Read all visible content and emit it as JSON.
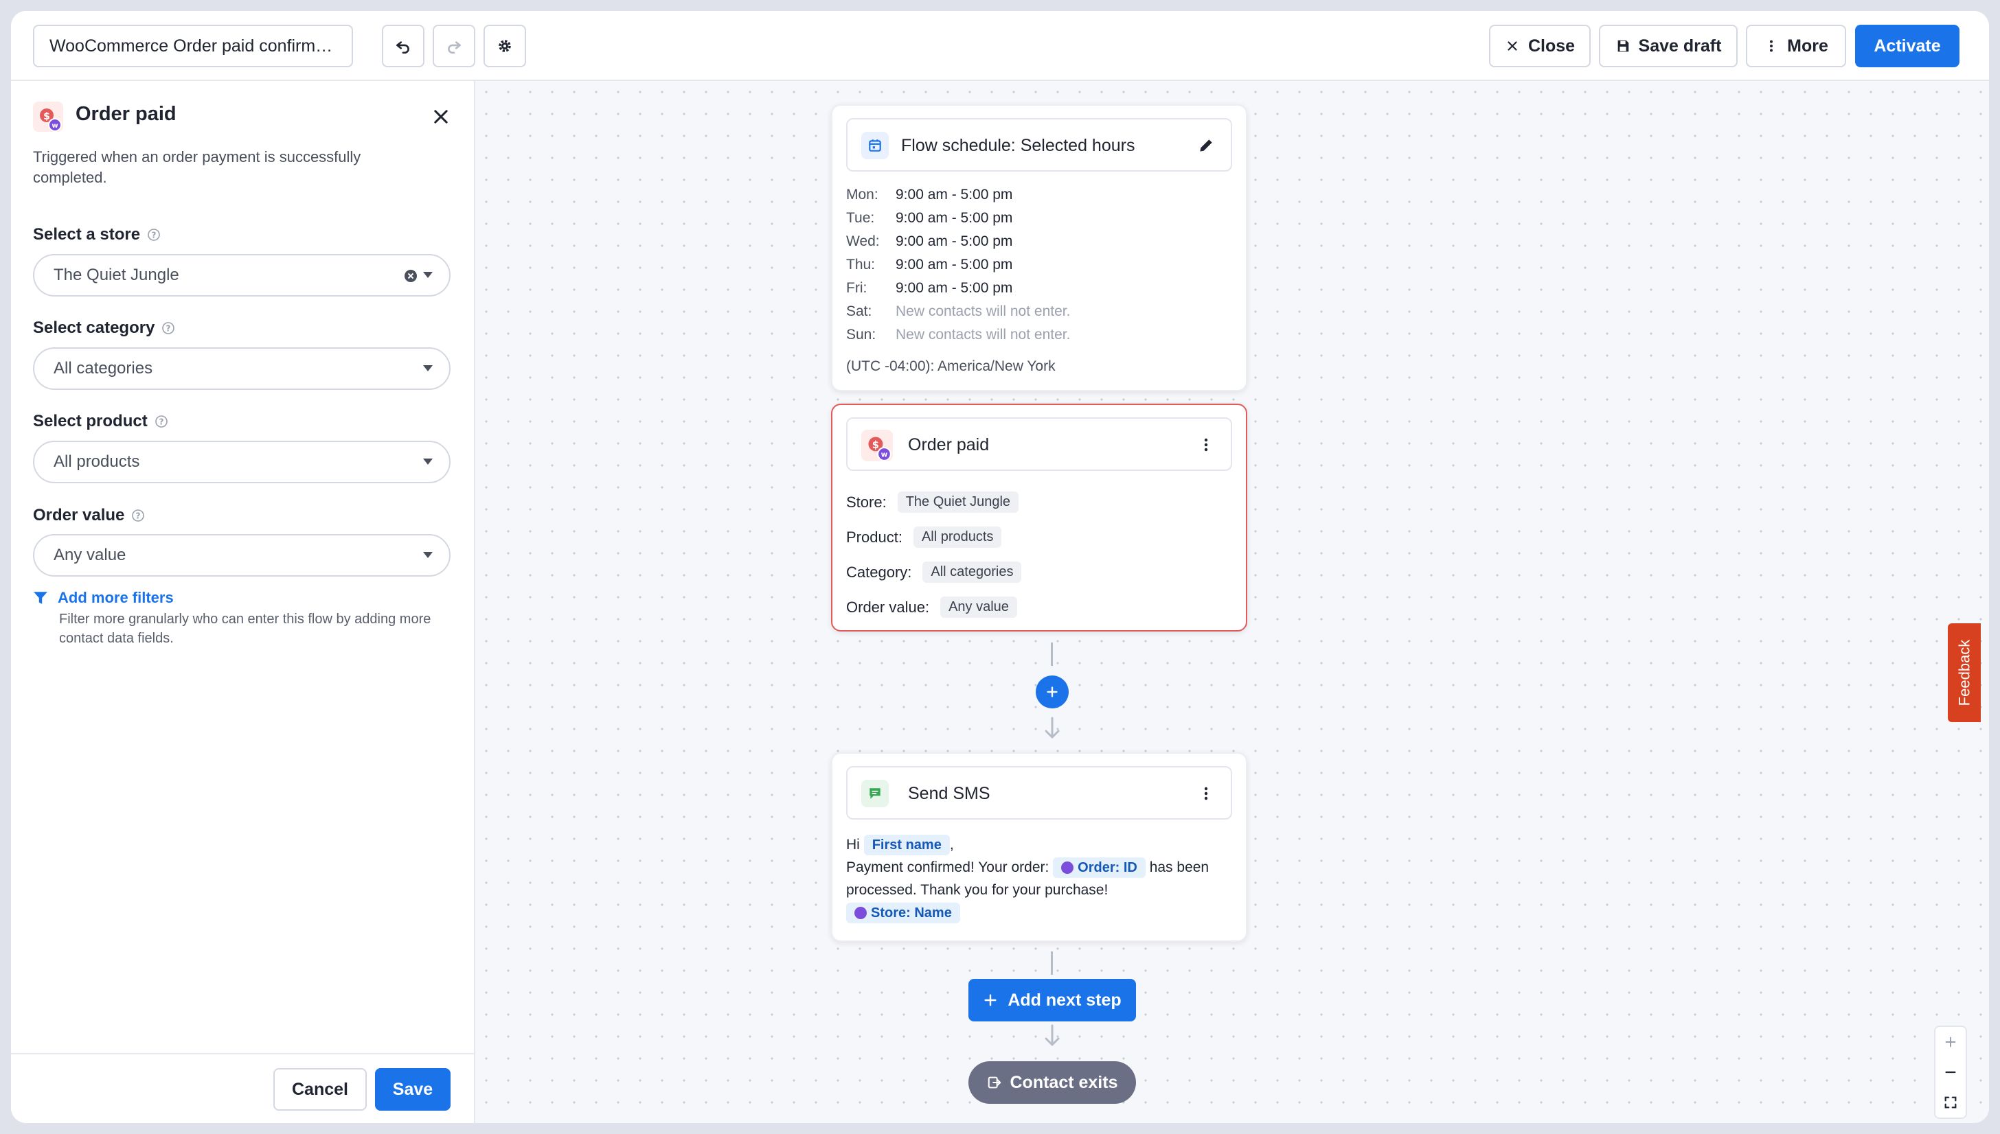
{
  "topbar": {
    "flow_name": "WooCommerce Order paid confirma...",
    "close_label": "Close",
    "save_draft_label": "Save draft",
    "more_label": "More",
    "activate_label": "Activate"
  },
  "panel": {
    "title": "Order paid",
    "description": "Triggered when an order payment is successfully completed.",
    "store_label": "Select a store",
    "store_value": "The Quiet Jungle",
    "category_label": "Select category",
    "category_value": "All categories",
    "product_label": "Select product",
    "product_value": "All products",
    "order_value_label": "Order value",
    "order_value_value": "Any value",
    "add_filters_label": "Add more filters",
    "add_filters_desc": "Filter more granularly who can enter this flow by adding more contact data fields.",
    "cancel_label": "Cancel",
    "save_label": "Save"
  },
  "schedule_card": {
    "title": "Flow schedule: Selected hours",
    "rows": [
      {
        "day": "Mon:",
        "hours": "9:00 am - 5:00 pm"
      },
      {
        "day": "Tue:",
        "hours": "9:00 am - 5:00 pm"
      },
      {
        "day": "Wed:",
        "hours": "9:00 am - 5:00 pm"
      },
      {
        "day": "Thu:",
        "hours": "9:00 am - 5:00 pm"
      },
      {
        "day": "Fri:",
        "hours": "9:00 am - 5:00 pm"
      },
      {
        "day": "Sat:",
        "hours": "New contacts will not enter."
      },
      {
        "day": "Sun:",
        "hours": "New contacts will not enter."
      }
    ],
    "timezone": "(UTC -04:00): America/New York"
  },
  "trigger_card": {
    "title": "Order paid",
    "store_key": "Store:",
    "store_val": "The Quiet Jungle",
    "product_key": "Product:",
    "product_val": "All products",
    "category_key": "Category:",
    "category_val": "All categories",
    "order_value_key": "Order value:",
    "order_value_val": "Any value"
  },
  "sms_card": {
    "title": "Send SMS",
    "greeting": "Hi",
    "tag_first_name": "First name",
    "comma": ",",
    "line2_text": "Payment confirmed! Your order:",
    "tag_order_id": "Order: ID",
    "line2_after": "has been",
    "line3_text": "processed. Thank you for your purchase!",
    "tag_store_name": "Store: Name"
  },
  "flow": {
    "add_next_step_label": "Add next step",
    "contact_exits_label": "Contact exits"
  },
  "feedback_label": "Feedback",
  "colors": {
    "primary": "#1a73e8",
    "trigger_border": "#e35a5a",
    "exit_pill": "#6b6f86",
    "feedback": "#d7411f",
    "tag_purple": "#7c4ddb"
  }
}
